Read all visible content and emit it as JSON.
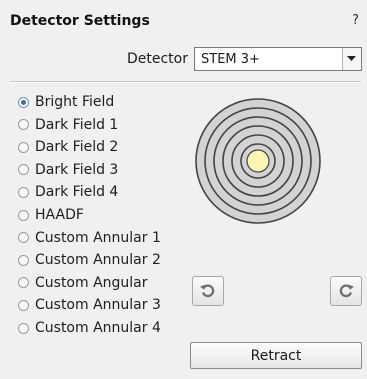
{
  "panel": {
    "title": "Detector Settings",
    "help": "?"
  },
  "detector": {
    "label": "Detector",
    "selected": "STEM 3+"
  },
  "modes": [
    {
      "label": "Bright Field",
      "checked": true
    },
    {
      "label": "Dark Field 1",
      "checked": false
    },
    {
      "label": "Dark Field 2",
      "checked": false
    },
    {
      "label": "Dark Field 3",
      "checked": false
    },
    {
      "label": "Dark Field 4",
      "checked": false
    },
    {
      "label": "HAADF",
      "checked": false
    },
    {
      "label": "Custom Annular 1",
      "checked": false
    },
    {
      "label": "Custom Annular 2",
      "checked": false
    },
    {
      "label": "Custom Angular",
      "checked": false
    },
    {
      "label": "Custom Annular 3",
      "checked": false
    },
    {
      "label": "Custom Annular 4",
      "checked": false
    }
  ],
  "diagram": {
    "ring_count": 6,
    "ring_color": "#444444",
    "disk_fill": "#d3d3d3",
    "center_color": "#fbf6b4"
  },
  "buttons": {
    "retract": "Retract",
    "rotate_ccw_icon": "rotate-ccw-icon",
    "rotate_cw_icon": "rotate-cw-icon"
  }
}
